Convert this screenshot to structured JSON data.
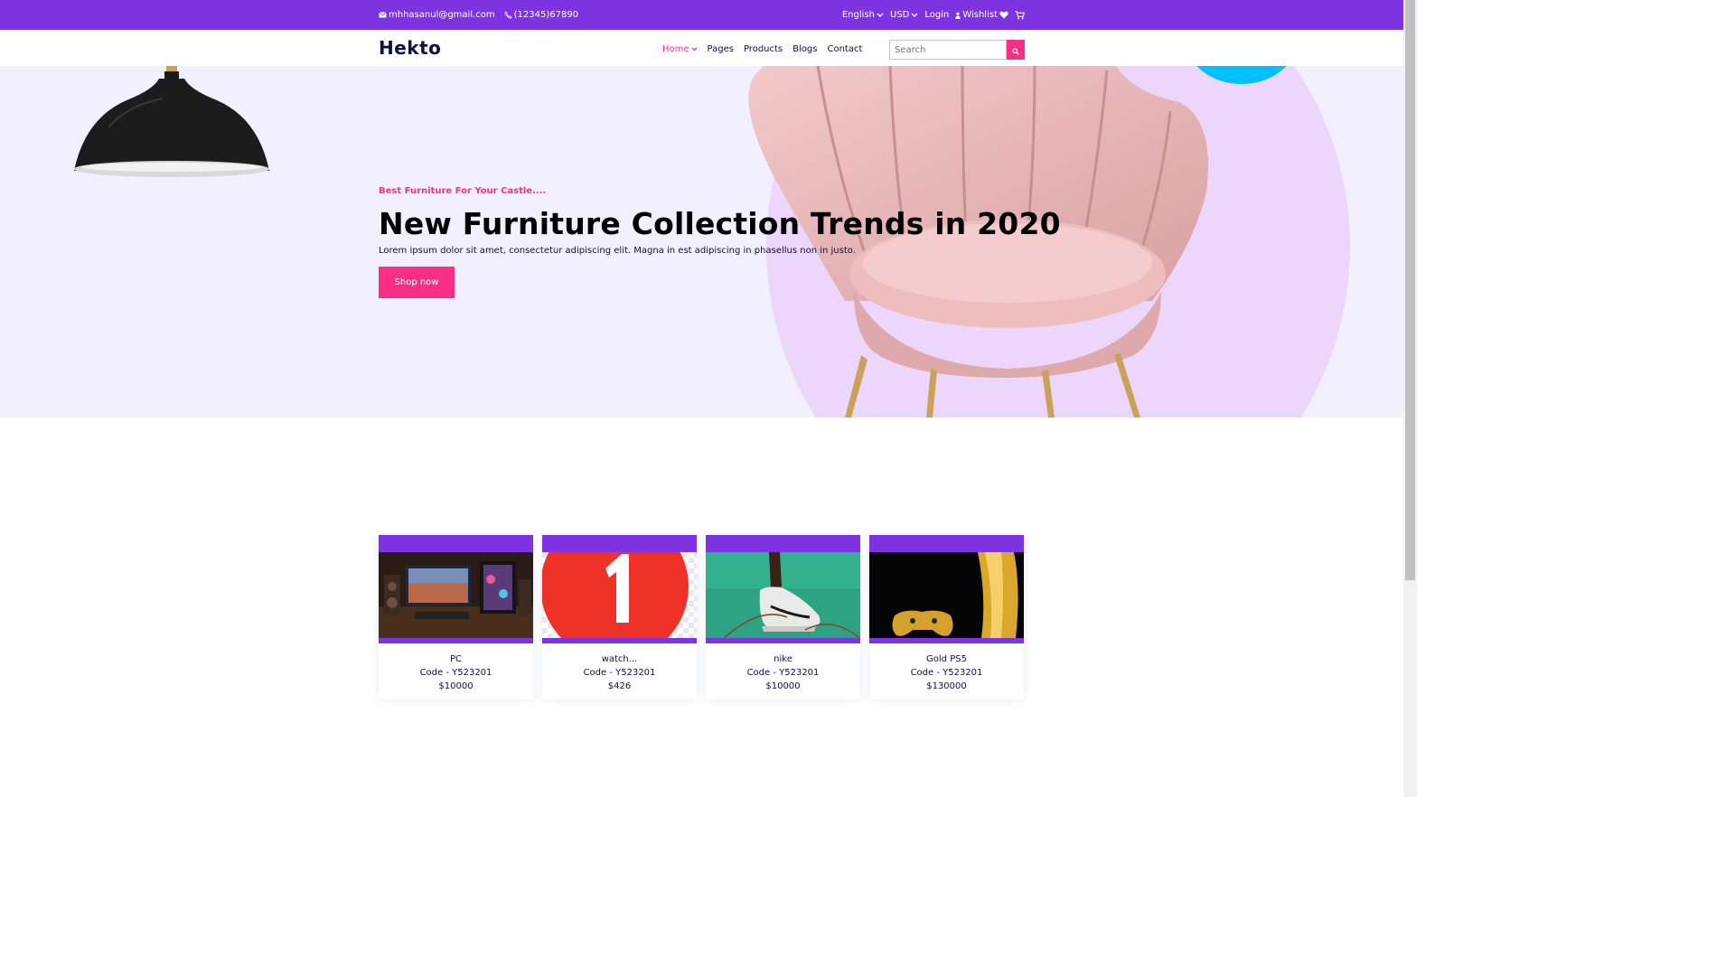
{
  "topbar": {
    "email": "mhhasanul@gmail.com",
    "phone": "(12345)67890",
    "language": "English",
    "currency": "USD",
    "login": "Login",
    "wishlist": "Wishlist"
  },
  "nav": {
    "logo": "Hekto",
    "items": [
      "Home",
      "Pages",
      "Products",
      "Blogs",
      "Contact"
    ],
    "search_placeholder": "Search"
  },
  "hero": {
    "kicker": "Best Furniture For Your Castle....",
    "headline": "New Furniture Collection Trends in 2020",
    "description": "Lorem ipsum dolor sit amet, consectetur adipiscing elit. Magna in est adipiscing in phasellus non in justo.",
    "cta": "Shop now"
  },
  "products": [
    {
      "name": "PC",
      "code": "Code - Y523201",
      "price": "$10000"
    },
    {
      "name": "watch...",
      "code": "Code - Y523201",
      "price": "$426"
    },
    {
      "name": "nike",
      "code": "Code - Y523201",
      "price": "$10000"
    },
    {
      "name": "Gold PS5",
      "code": "Code - Y523201",
      "price": "$130000"
    }
  ],
  "colors": {
    "primary_purple": "#7E33E0",
    "accent_pink": "#FB2E86",
    "navy": "#0D0E43",
    "hero_bg": "#F2F0FF"
  }
}
